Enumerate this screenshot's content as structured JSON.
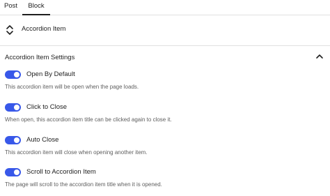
{
  "tabs": {
    "post_label": "Post",
    "block_label": "Block",
    "active": "Block"
  },
  "block_card": {
    "icon": "accordion-arrows-icon",
    "title": "Accordion Item"
  },
  "panel": {
    "title": "Accordion Item Settings",
    "expanded": true,
    "chevron_icon": "chevron-up-icon"
  },
  "settings": [
    {
      "label": "Open By Default",
      "help": "This accordion item will be open when the page loads.",
      "enabled": true
    },
    {
      "label": "Click to Close",
      "help": "When open, this accordion item title can be clicked again to close it.",
      "enabled": true
    },
    {
      "label": "Auto Close",
      "help": "This accordion item will close when opening another item.",
      "enabled": true
    },
    {
      "label": "Scroll to Accordion Item",
      "help": "The page will scroll to the accordion item title when it is opened.",
      "enabled": true
    }
  ],
  "colors": {
    "toggle_on": "#3858e9",
    "text": "#1e1e1e",
    "help_text": "#5e5e5e",
    "divider": "#e0e0e0"
  }
}
